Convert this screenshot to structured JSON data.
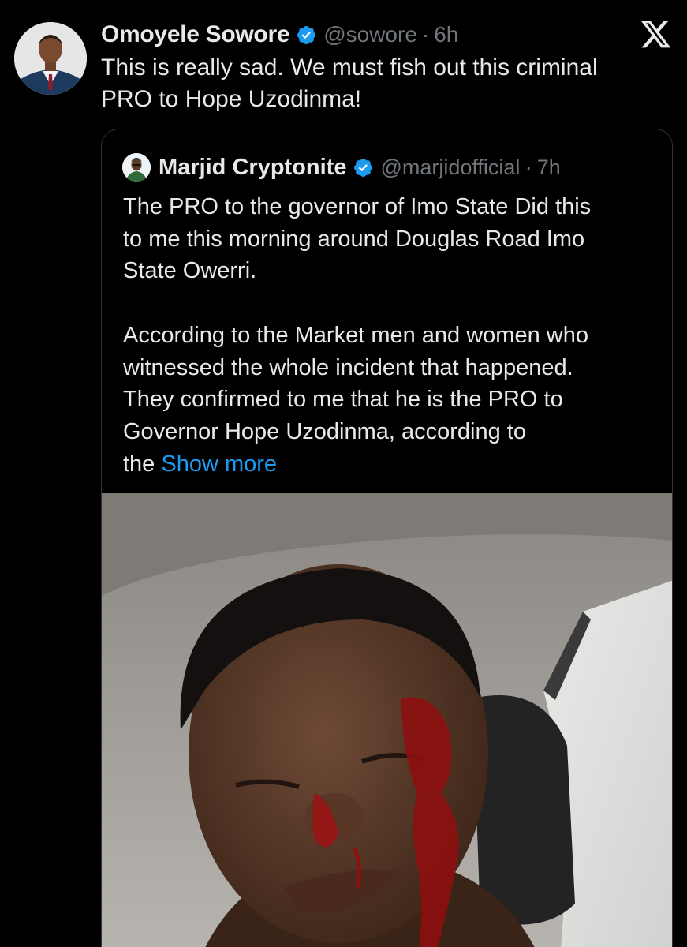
{
  "tweet": {
    "author_name": "Omoyele Sowore",
    "handle": "@sowore",
    "separator": "·",
    "time": "6h",
    "text_lines": [
      "This is really sad. We must fish out this criminal",
      "PRO to Hope Uzodinma!"
    ]
  },
  "quote": {
    "author_name": "Marjid Cryptonite",
    "handle": "@marjidofficial",
    "separator": "·",
    "time": "7h",
    "paragraph1_lines": [
      "The PRO to the governor of Imo State Did this",
      "to me this morning around Douglas Road Imo",
      "State Owerri."
    ],
    "paragraph2_lines": [
      "According to the Market men and women who",
      "witnessed the whole incident that happened.",
      "They confirmed to me that he is the PRO to",
      "Governor Hope Uzodinma, according to"
    ],
    "last_line_prefix": "the ",
    "show_more_label": "Show more"
  },
  "icons": {
    "verified": "verified-badge-icon",
    "x_logo": "x-logo-icon"
  },
  "colors": {
    "background": "#000000",
    "text_primary": "#e7e9ea",
    "text_secondary": "#71767b",
    "accent": "#1d9bf0",
    "border": "#2f3336"
  }
}
